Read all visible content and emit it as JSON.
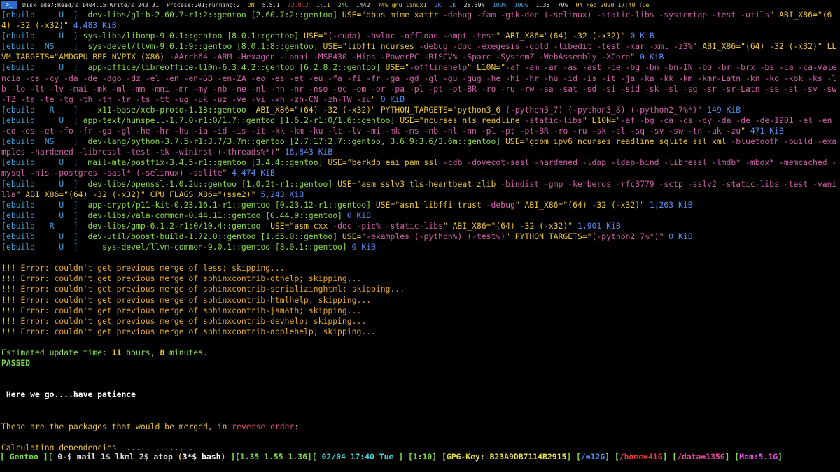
{
  "topbar": {
    "terminal_icon": "&gt;_",
    "disk": "Disk:sda7:Read/s:1404.15:Write/s:243.31",
    "process": "Process:201;running:2",
    "on": "ON",
    "kernel": "5.5.1",
    "temp": "72.0.2",
    "uptime": "1:11",
    "weather": "24C",
    "pkgs": "1442",
    "wifi": "74% gnu_linux1",
    "net_down": "2K",
    "net_up": "1K",
    "cpu": "28.39%",
    "bright": "100%",
    "vol": "100%",
    "load": "1.38",
    "battery": "70%",
    "datetime": "04 Feb 2020 17:40 Tue"
  },
  "colors": {
    "ebuild": "#3aa0d8",
    "status": "#3aa0d8",
    "pkg": "#8ad84a",
    "version": "#e8c23a",
    "use": "#e8c23a",
    "disabled": "#c8509e",
    "size": "#5a8cf0",
    "error_excl": "#e8d030",
    "error_text": "#e8a828",
    "passed": "#7ad84a"
  },
  "lines": [
    [
      [
        "[ebuild     U  ]  ",
        "ebuild"
      ],
      [
        "dev-libs/glib-2.60.7-r1:2::gentoo [2.60.7:2::gentoo] ",
        "pkg"
      ],
      [
        "USE=\"dbus mime xattr ",
        "use"
      ],
      [
        "-debug -fam -gtk-doc (-selinux) -static-libs -systemtap -test -utils",
        "disabled"
      ],
      [
        "\" ABI_X86=\"(64) -32 (-x32)\" ",
        "use"
      ],
      [
        "4,483 KiB",
        "size"
      ]
    ],
    [
      [
        "[ebuild     U  ] ",
        "ebuild"
      ],
      [
        "sys-libs/libomp-9.0.1::gentoo [8.0.1::gentoo] ",
        "pkg"
      ],
      [
        "USE=\"",
        "use"
      ],
      [
        "(-cuda) -hwloc -offload -ompt -test",
        "disabled"
      ],
      [
        "\" ABI_X86=\"(64) -32 (-x32)\" ",
        "use"
      ],
      [
        "0 KiB",
        "size"
      ]
    ],
    [
      [
        "[ebuild  NS    ]  ",
        "ebuild"
      ],
      [
        "sys-devel/llvm-9.0.1:9::gentoo [8.0.1:8::gentoo] ",
        "pkg"
      ],
      [
        "USE=\"libffi ncurses ",
        "use"
      ],
      [
        "-debug -doc -exegesis -gold -libedit -test -xar -xml -z3%",
        "disabled"
      ],
      [
        "\" ABI_X86=\"(64) -32 (-x32)\" LLVM_TARGETS=\"AMDGPU BPF NVPTX (X86) ",
        "use"
      ],
      [
        "-AArch64 -ARM -Hexagon -Lanai -MSP430 -Mips -PowerPC -RISCV% -Sparc -SystemZ -WebAssembly -XCore",
        "disabled"
      ],
      [
        "\" ",
        "use"
      ],
      [
        "0 KiB",
        "size"
      ]
    ],
    [
      [
        "[ebuild     U  ]  ",
        "ebuild"
      ],
      [
        "app-office/libreoffice-l10n-6.3.4.2::gentoo [6.2.8.2::gentoo] ",
        "pkg"
      ],
      [
        "USE=\"",
        "use"
      ],
      [
        "-offlinehelp",
        "disabled"
      ],
      [
        "\" L10N=\"",
        "use"
      ],
      [
        "-af -am -ar -as -ast -be -bg -bn -bn-IN -bo -br -brx -bs -ca -ca-valencia -cs -cy -da -de -dgo -dz -el -en -en-GB -en-ZA -eo -es -et -eu -fa -fi -fr -ga -gd -gl -gu -gug -he -hi -hr -hu -id -is -it -ja -ka -kk -km -kmr-Latn -kn -ko -kok -ks -lb -lo -lt -lv -mai -mk -ml -mn -mni -mr -my -nb -ne -nl -nn -nr -nso -oc -om -or -pa -pl -pt -pt-BR -ro -ru -rw -sa -sat -sd -si -sid -sk -sl -sq -sr -sr-Latn -ss -st -sv -sw-TZ -ta -te -tg -th -tn -tr -ts -tt -ug -uk -uz -ve -vi -xh -zh-CN -zh-TW -zu",
        "disabled"
      ],
      [
        "\" ",
        "use"
      ],
      [
        "0 KiB",
        "size"
      ]
    ],
    [
      [
        "[ebuild   R    ]    ",
        "ebuild"
      ],
      [
        "x11-base/xcb-proto-1.13::gentoo  ",
        "pkg"
      ],
      [
        "ABI_X86=\"(64) -32 (-x32)\" PYTHON_TARGETS=\"python3_6 ",
        "use"
      ],
      [
        "(-python3_7) (-python3_8) (-python2_7%*)",
        "disabled"
      ],
      [
        "\" ",
        "use"
      ],
      [
        "149 KiB",
        "size"
      ]
    ],
    [
      [
        "[ebuild     U  ] ",
        "ebuild"
      ],
      [
        "app-text/hunspell-1.7.0-r1:0/1.7::gentoo [1.6.2-r1:0/1.6::gentoo] ",
        "pkg"
      ],
      [
        "USE=\"ncurses nls readline ",
        "use"
      ],
      [
        "-static-libs",
        "disabled"
      ],
      [
        "\" L10N=\"",
        "use"
      ],
      [
        "-af -bg -ca -cs -cy -da -de -de-1901 -el -en -eo -es -et -fo -fr -ga -gl -he -hr -hu -ia -id -is -it -kk -km -ku -lt -lv -mi -mk -ms -nb -nl -nn -pl -pt -pt-BR -ro -ru -sk -sl -sq -sv -sw -tn -uk -zu",
        "disabled"
      ],
      [
        "\" ",
        "use"
      ],
      [
        "471 KiB",
        "size"
      ]
    ],
    [
      [
        "[ebuild  NS    ]  ",
        "ebuild"
      ],
      [
        "dev-lang/python-3.7.5-r1:3.7/3.7m::gentoo [2.7.17:2.7::gentoo, 3.6.9:3.6/3.6m::gentoo] ",
        "pkg"
      ],
      [
        "USE=\"gdbm ipv6 ncurses readline sqlite ssl xml ",
        "use"
      ],
      [
        "-bluetooth -build -examples -hardened -libressl -test -tk -wininst (-threads%*)",
        "disabled"
      ],
      [
        "\" ",
        "use"
      ],
      [
        "16,843 KiB",
        "size"
      ]
    ],
    [
      [
        "[ebuild     U  ]  ",
        "ebuild"
      ],
      [
        "mail-mta/postfix-3.4.5-r1::gentoo [3.4.4::gentoo] ",
        "pkg"
      ],
      [
        "USE=\"berkdb eai pam ssl ",
        "use"
      ],
      [
        "-cdb -dovecot-sasl -hardened -ldap -ldap-bind -libressl -lmdb* -mbox* -memcached -mysql -nis -postgres -sasl* (-selinux) -sqlite",
        "disabled"
      ],
      [
        "\" ",
        "use"
      ],
      [
        "4,474 KiB",
        "size"
      ]
    ],
    [
      [
        "[ebuild     U  ]  ",
        "ebuild"
      ],
      [
        "dev-libs/openssl-1.0.2u::gentoo [1.0.2t-r1::gentoo] ",
        "pkg"
      ],
      [
        "USE=\"asm sslv3 tls-heartbeat zlib ",
        "use"
      ],
      [
        "-bindist -gmp -kerberos -rfc3779 -sctp -sslv2 -static-libs -test -vanilla",
        "disabled"
      ],
      [
        "\" ABI_X86=\"(64) -32 (-x32)\" CPU_FLAGS_X86=\"(sse2)\" ",
        "use"
      ],
      [
        "5,243 KiB",
        "size"
      ]
    ],
    [
      [
        "[ebuild     U  ]  ",
        "ebuild"
      ],
      [
        "app-crypt/p11-kit-0.23.16.1-r1::gentoo [0.23.12-r1::gentoo] ",
        "pkg"
      ],
      [
        "USE=\"asn1 libffi trust ",
        "use"
      ],
      [
        "-debug",
        "disabled"
      ],
      [
        "\" ABI_X86=\"(64) -32 (-x32)\" ",
        "use"
      ],
      [
        "1,263 KiB",
        "size"
      ]
    ],
    [
      [
        "[ebuild     U  ]  ",
        "ebuild"
      ],
      [
        "dev-libs/vala-common-0.44.11::gentoo [0.44.9::gentoo] ",
        "pkg"
      ],
      [
        "0 KiB",
        "size"
      ]
    ],
    [
      [
        "[ebuild   R    ]  ",
        "ebuild"
      ],
      [
        "dev-libs/gmp-6.1.2-r1:0/10.4::gentoo  ",
        "pkg"
      ],
      [
        "USE=\"asm cxx ",
        "use"
      ],
      [
        "-doc -pic% -static-libs",
        "disabled"
      ],
      [
        "\" ABI_X86=\"(64) -32 (-x32)\" ",
        "use"
      ],
      [
        "1,901 KiB",
        "size"
      ]
    ],
    [
      [
        "[ebuild     U  ]  ",
        "ebuild"
      ],
      [
        "dev-util/boost-build-1.72.0::gentoo [1.65.0::gentoo] ",
        "pkg"
      ],
      [
        "USE=\"",
        "use"
      ],
      [
        "-examples (-python%) (-test%)",
        "disabled"
      ],
      [
        "\" PYTHON_TARGETS=\"",
        "use"
      ],
      [
        "(-python2_7%*)",
        "disabled"
      ],
      [
        "\" ",
        "use"
      ],
      [
        "0 KiB",
        "size"
      ]
    ],
    [
      [
        "[ebuild     U  ]     ",
        "ebuild"
      ],
      [
        "sys-devel/llvm-common-9.0.1::gentoo [8.0.1::gentoo] ",
        "pkg"
      ],
      [
        "0 KiB",
        "size"
      ]
    ],
    [],
    [
      [
        "!!! ",
        "error_excl"
      ],
      [
        "Error: couldn't get previous merge of less; skipping...",
        "error_text"
      ]
    ],
    [
      [
        "!!! ",
        "error_excl"
      ],
      [
        "Error: couldn't get previous merge of sphinxcontrib-qthelp; skipping...",
        "error_text"
      ]
    ],
    [
      [
        "!!! ",
        "error_excl"
      ],
      [
        "Error: couldn't get previous merge of sphinxcontrib-serializinghtml; skipping...",
        "error_text"
      ]
    ],
    [
      [
        "!!! ",
        "error_excl"
      ],
      [
        "Error: couldn't get previous merge of sphinxcontrib-htmlhelp; skipping...",
        "error_text"
      ]
    ],
    [
      [
        "!!! ",
        "error_excl"
      ],
      [
        "Error: couldn't get previous merge of sphinxcontrib-jsmath; skipping...",
        "error_text"
      ]
    ],
    [
      [
        "!!! ",
        "error_excl"
      ],
      [
        "Error: couldn't get previous merge of sphinxcontrib-devhelp; skipping...",
        "error_text"
      ]
    ],
    [
      [
        "!!! ",
        "error_excl"
      ],
      [
        "Error: couldn't get previous merge of sphinxcontrib-applehelp; skipping...",
        "error_text"
      ]
    ],
    [],
    [
      [
        "Estimated update time: ",
        "estimate"
      ],
      [
        "11",
        "estimate_num"
      ],
      [
        " hours, ",
        "estimate"
      ],
      [
        "8",
        "estimate_num"
      ],
      [
        " minutes.",
        "estimate"
      ]
    ],
    [
      [
        "PASSED",
        "passed"
      ]
    ],
    [],
    [],
    [
      [
        " Here we go....have patience",
        "patience"
      ]
    ],
    [],
    [],
    [
      [
        "These are the packages that would be merged, in ",
        "merge"
      ],
      [
        "reverse order",
        "reverse"
      ],
      [
        ":",
        "merge"
      ]
    ],
    [],
    [
      [
        "Calculating dependencies  ..... ...... .",
        "calc"
      ]
    ]
  ],
  "status": [
    [
      "[ Gentoo ][",
      "#7ad84a"
    ],
    [
      "  0-$ mail  1$ lkml  2$ atop ",
      "#ddd"
    ],
    [
      "(",
      "#e8c23a"
    ],
    [
      "3*$ bash",
      "#fff"
    ],
    [
      ")",
      "#e8c23a"
    ],
    [
      "   ][1.35 1.55 1.36][",
      "#7ad84a"
    ],
    [
      " 02/04 17:40 Tue ",
      "#3ad8d8"
    ],
    [
      "]   [",
      "#7ad84a"
    ],
    [
      "1:10",
      "#7ad84a"
    ],
    [
      "] [",
      "#7ad84a"
    ],
    [
      "GPG-Key: ",
      "#e8e04a"
    ],
    [
      "B23A9DB7114B2915",
      "#e8e04a"
    ],
    [
      "] [",
      "#7ad84a"
    ],
    [
      "/=12G",
      "#5a8cf0"
    ],
    [
      "] [",
      "#7ad84a"
    ],
    [
      "/home=41G",
      "#e83a3a"
    ],
    [
      "] [",
      "#7ad84a"
    ],
    [
      "/data=135G",
      "#e84a9a"
    ],
    [
      "] [",
      "#7ad84a"
    ],
    [
      "Mem:5.1G",
      "#e84ae8"
    ],
    [
      "]",
      "#7ad84a"
    ]
  ]
}
